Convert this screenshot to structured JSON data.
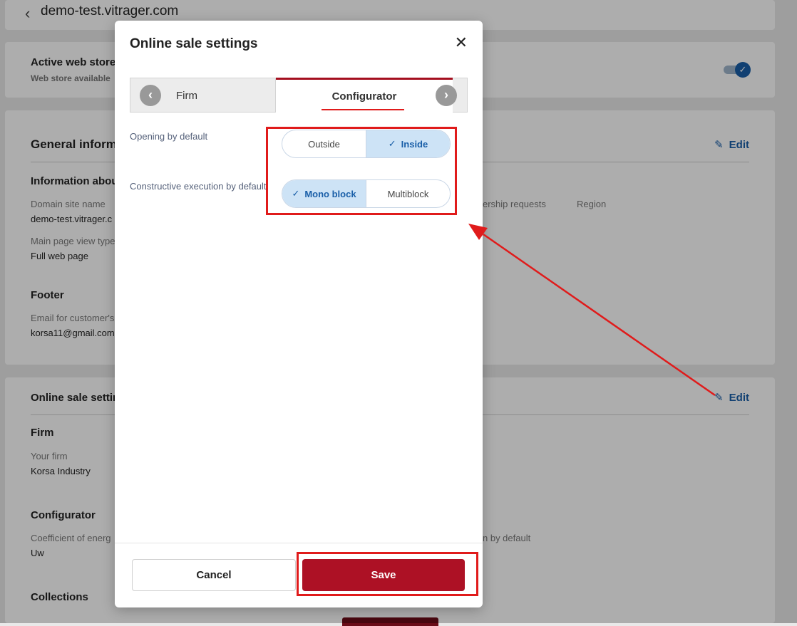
{
  "page": {
    "site_title": "demo-test.vitrager.com",
    "web_store": {
      "title": "Active web store",
      "subtitle": "Web store available"
    },
    "general": {
      "title": "General informa",
      "edit_label": "Edit",
      "info_heading": "Information abou",
      "domain_label": "Domain site name",
      "domain_value": "demo-test.vitrager.c",
      "partial_col_label": "ership requests",
      "region_label": "Region",
      "view_type_label": "Main page view type",
      "view_type_value": "Full web page",
      "footer_heading": "Footer",
      "email_label": "Email for customer's",
      "email_value": "korsa11@gmail.com"
    },
    "online_sale": {
      "title": "Online sale settin",
      "edit_label": "Edit",
      "firm_heading": "Firm",
      "your_firm_label": "Your firm",
      "your_firm_value": "Korsa Industry",
      "configurator_heading": "Configurator",
      "coef_label": "Coefficient of energ",
      "coef_value": "Uw",
      "partial_right_label": "n by default",
      "collections_heading": "Collections"
    }
  },
  "modal": {
    "title": "Online sale settings",
    "close_glyph": "✕",
    "tabs": [
      {
        "label": "Firm",
        "active": false
      },
      {
        "label": "Configurator",
        "active": true
      }
    ],
    "fields": [
      {
        "label": "Opening by default",
        "options": [
          {
            "label": "Outside",
            "selected": false
          },
          {
            "label": "Inside",
            "selected": true
          }
        ]
      },
      {
        "label": "Constructive execution by default",
        "options": [
          {
            "label": "Mono block",
            "selected": true
          },
          {
            "label": "Multiblock",
            "selected": false
          }
        ]
      }
    ],
    "cancel_label": "Cancel",
    "save_label": "Save"
  },
  "colors": {
    "accent_red": "#ad1125",
    "link_blue": "#1a5fa8",
    "annotation_red": "#e01b1b"
  }
}
